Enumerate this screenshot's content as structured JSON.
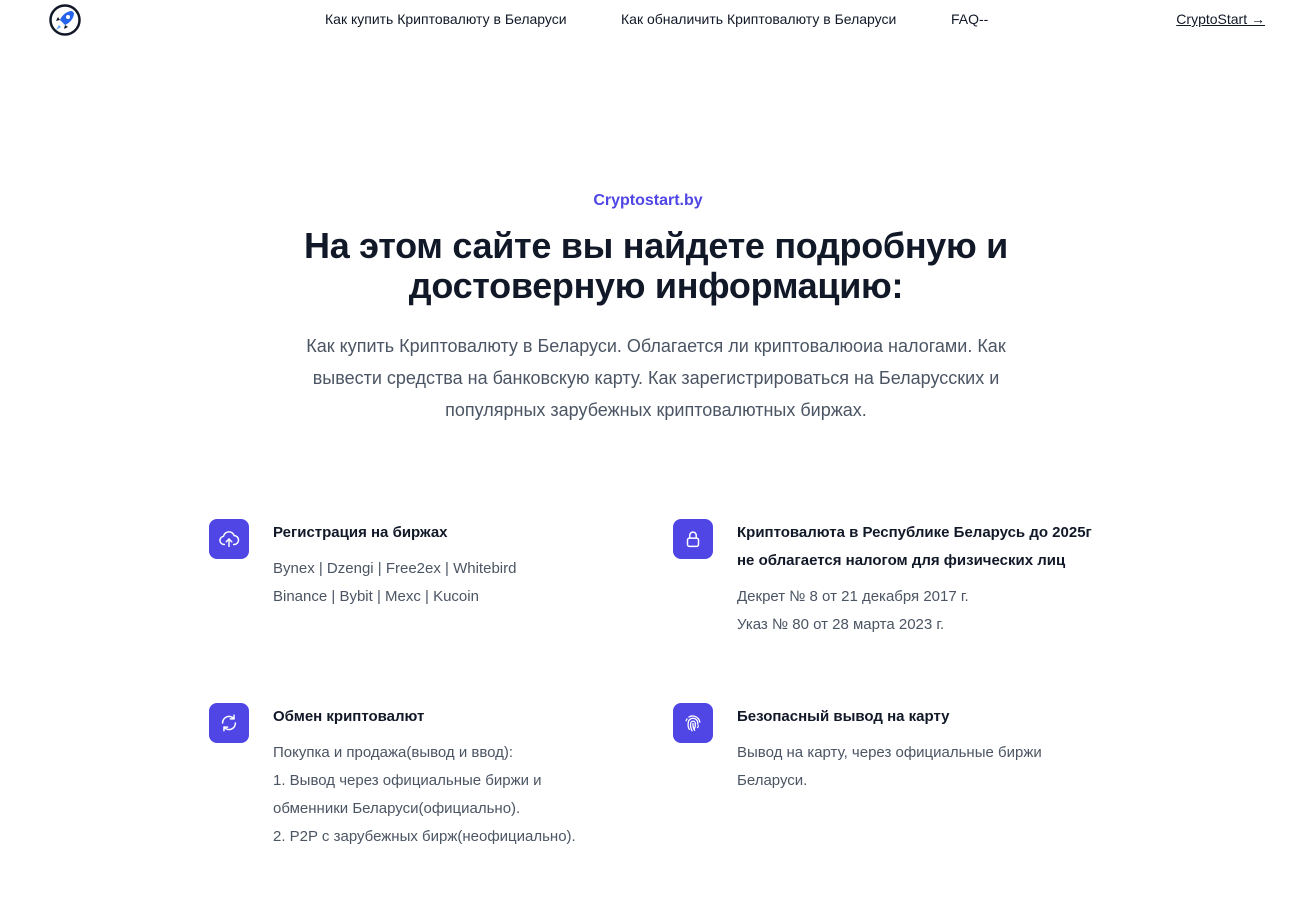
{
  "nav": {
    "links": [
      "Как купить Криптовалюту в Беларуси",
      "Как обналичить Криптовалюту в Беларуси",
      "FAQ--"
    ],
    "cta": "CryptoStart →",
    "logo_icon": "rocket-logo-icon"
  },
  "hero": {
    "eyebrow": "Cryptostart.by",
    "headline": "На этом сайте вы найдете подробную и достоверную информацию:",
    "lead": "Как купить Криптовалюту в Беларуси. Облагается ли криптовалюоиа налогами. Как вывести средства на банковскую карту. Как зарегистрироваться на Беларусских и популярных зарубежных криптовалютных биржах."
  },
  "accent_color": "#4f46e5",
  "features": [
    {
      "icon": "cloud-upload-icon",
      "title": "Регистрация на биржах",
      "lines": [
        "Bynex | Dzengi | Free2ex | Whitebird",
        "Binance | Bybit | Mexc | Kucoin"
      ]
    },
    {
      "icon": "lock-icon",
      "title": "Криптовалюта в Республике Беларусь до 2025г не облагается налогом для физических лиц",
      "lines": [
        "Декрет № 8 от 21 декабря 2017 г.",
        "Указ № 80 от 28 марта 2023 г."
      ]
    },
    {
      "icon": "refresh-icon",
      "title": "Обмен криптовалют",
      "lines": [
        "Покупка и продажа(вывод и ввод):",
        "1. Вывод через официальные биржи и",
        "обменники Беларуси(официально).",
        "2. P2P с зарубежных бирж(неофициально)."
      ]
    },
    {
      "icon": "fingerprint-icon",
      "title": "Безопасный вывод на карту",
      "lines": [
        "Вывод на карту, через официальные биржи",
        "Беларуси."
      ]
    }
  ]
}
